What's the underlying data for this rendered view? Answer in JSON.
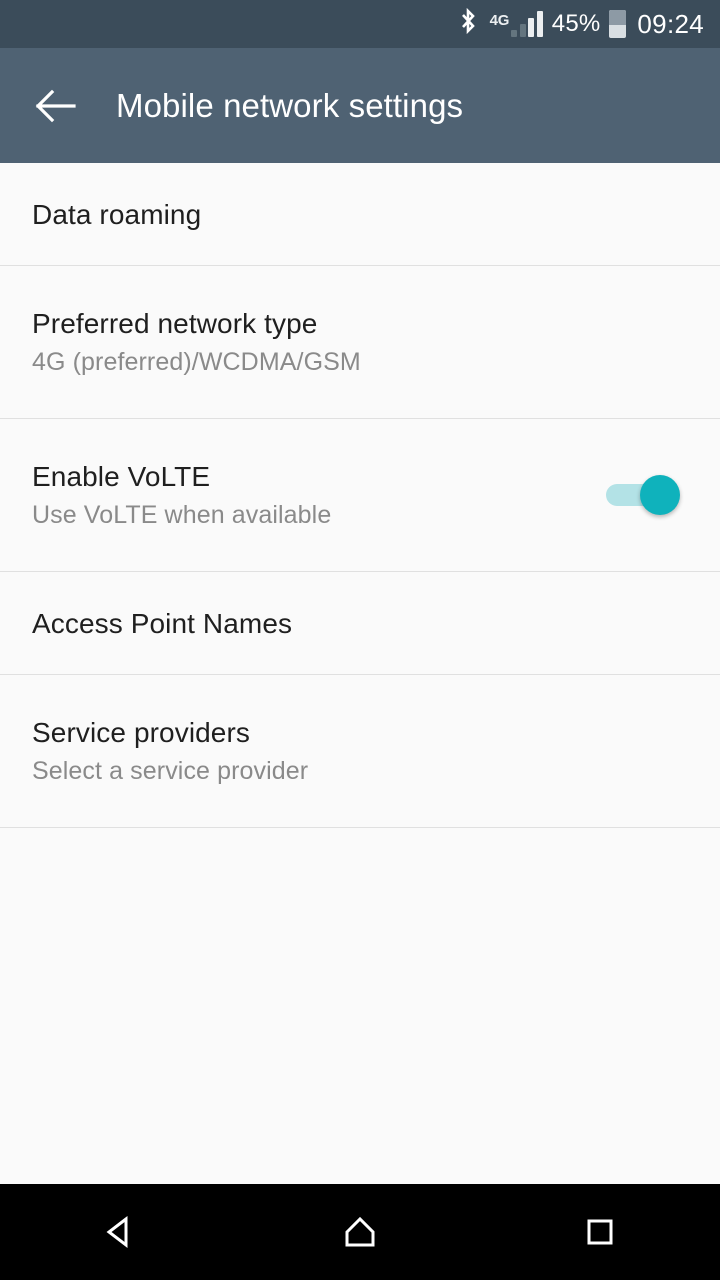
{
  "status_bar": {
    "bluetooth_icon": "bluetooth-icon",
    "network_type": "4G",
    "signal_icon": "signal-bars-icon",
    "signal_bars_active": 2,
    "signal_bars_total": 4,
    "battery_percent": "45%",
    "battery_icon": "battery-icon",
    "battery_level": 45,
    "clock": "09:24"
  },
  "app_bar": {
    "back_icon": "arrow-left-icon",
    "title": "Mobile network settings"
  },
  "settings": {
    "items": [
      {
        "name": "data-roaming",
        "title": "Data roaming",
        "subtitle": "",
        "type": "one-line",
        "control": "none"
      },
      {
        "name": "preferred-network-type",
        "title": "Preferred network type",
        "subtitle": "4G (preferred)/WCDMA/GSM",
        "type": "two-line",
        "control": "none"
      },
      {
        "name": "enable-volte",
        "title": "Enable VoLTE",
        "subtitle": "Use VoLTE when available",
        "type": "two-line",
        "control": "switch",
        "switch_state": "on"
      },
      {
        "name": "access-point-names",
        "title": "Access Point Names",
        "subtitle": "",
        "type": "one-line",
        "control": "none"
      },
      {
        "name": "service-providers",
        "title": "Service providers",
        "subtitle": "Select a service provider",
        "type": "two-line",
        "control": "none"
      }
    ]
  },
  "nav_bar": {
    "back": "back-triangle-icon",
    "home": "home-icon",
    "recents": "recents-square-icon"
  },
  "colors": {
    "status_bar_bg": "#3b4c5a",
    "app_bar_bg": "#4f6273",
    "content_bg": "#fafafa",
    "divider": "#e0e0e0",
    "title_text": "#1f1f1f",
    "subtitle_text": "#8a8a8a",
    "switch_thumb_on": "#0fb2bc",
    "switch_track_on": "#b3e2e6",
    "nav_bar_bg": "#000000"
  }
}
